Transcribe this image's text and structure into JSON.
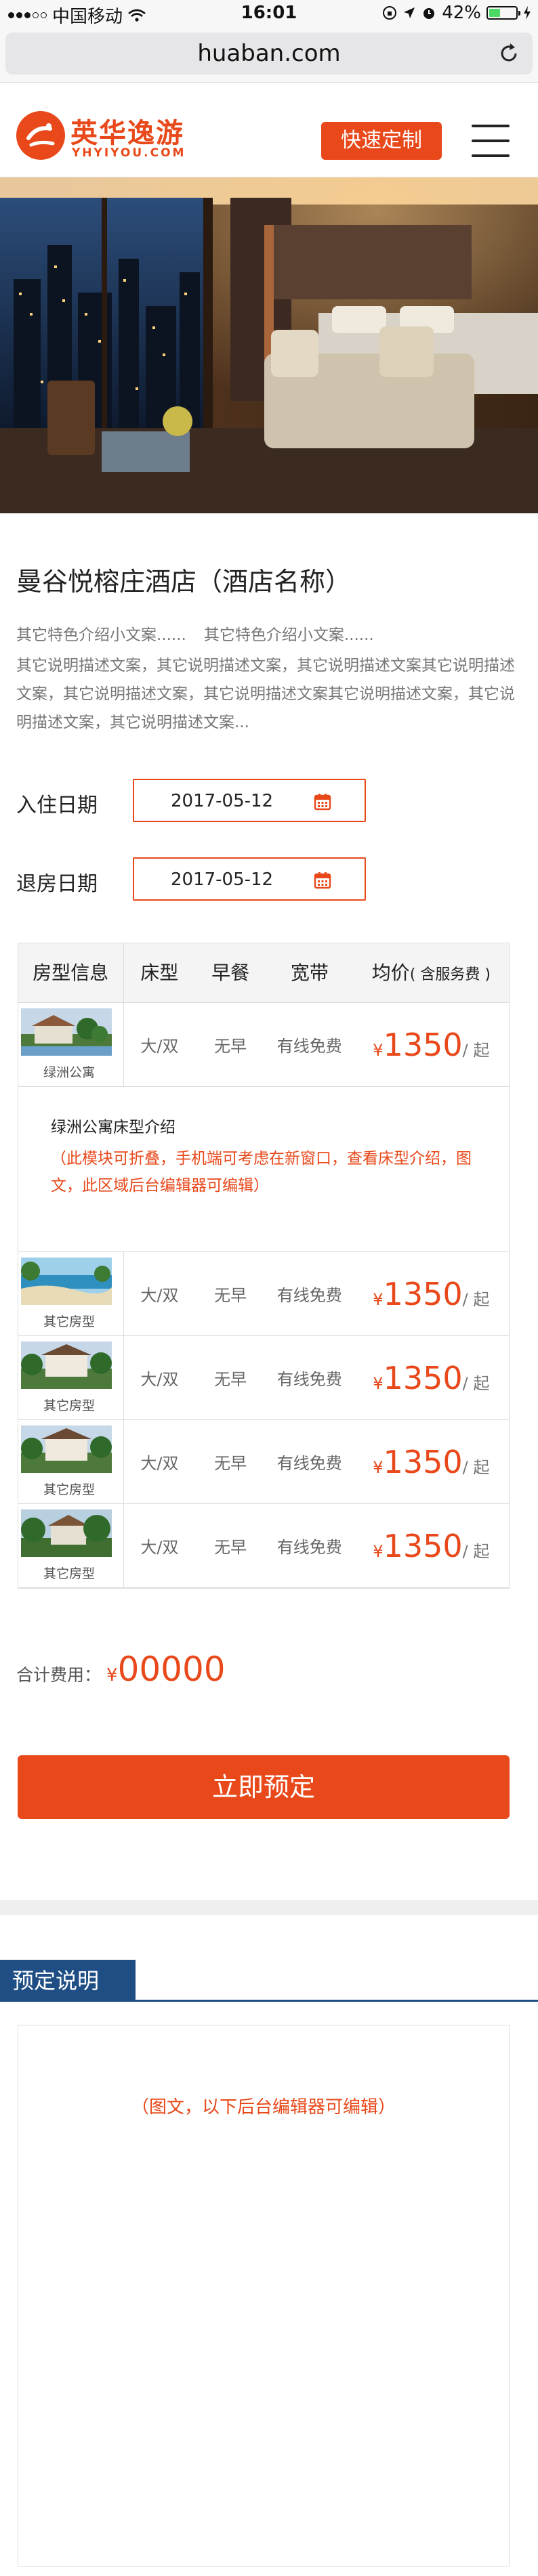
{
  "status_bar": {
    "carrier": "中国移动",
    "time": "16:01",
    "battery": "42%",
    "battery_level": 0.42
  },
  "browser": {
    "url": "huaban.com"
  },
  "header": {
    "logo_cn": "英华逸游",
    "logo_en": "YHYIYOU.COM",
    "quick_button": "快速定制"
  },
  "hotel": {
    "name": "曼谷悦榕庄酒店（酒店名称）",
    "intro": [
      "其它特色介绍小文案......",
      "其它特色介绍小文案......"
    ],
    "description": "其它说明描述文案，其它说明描述文案，其它说明描述文案其它说明描述文案，其它说明描述文案，其它说明描述文案其它说明描述文案，其它说明描述文案，其它说明描述文案..."
  },
  "booking": {
    "checkin_label": "入住日期",
    "checkin_value": "2017-05-12",
    "checkout_label": "退房日期",
    "checkout_value": "2017-05-12"
  },
  "room_table": {
    "headers": {
      "room": "房型信息",
      "bed": "床型",
      "breakfast": "早餐",
      "broadband": "宽带",
      "price": "均价",
      "price_note": "( 含服务费 )"
    },
    "rows": [
      {
        "name": "绿洲公寓",
        "bed": "大/双",
        "breakfast": "无早",
        "broadband": "有线免费",
        "currency": "¥",
        "price": "1350",
        "unit": "/ 起"
      },
      {
        "name": "其它房型",
        "bed": "大/双",
        "breakfast": "无早",
        "broadband": "有线免费",
        "currency": "¥",
        "price": "1350",
        "unit": "/ 起"
      },
      {
        "name": "其它房型",
        "bed": "大/双",
        "breakfast": "无早",
        "broadband": "有线免费",
        "currency": "¥",
        "price": "1350",
        "unit": "/ 起"
      },
      {
        "name": "其它房型",
        "bed": "大/双",
        "breakfast": "无早",
        "broadband": "有线免费",
        "currency": "¥",
        "price": "1350",
        "unit": "/ 起"
      },
      {
        "name": "其它房型",
        "bed": "大/双",
        "breakfast": "无早",
        "broadband": "有线免费",
        "currency": "¥",
        "price": "1350",
        "unit": "/ 起"
      }
    ],
    "intro_title": "绿洲公寓床型介绍",
    "intro_text": "（此模块可折叠，手机端可考虑在新窗口，查看床型介绍，图文，此区域后台编辑器可编辑）"
  },
  "total": {
    "label": "合计费用：",
    "currency": "¥",
    "value": "00000"
  },
  "book_button": "立即预定",
  "notes": {
    "title": "预定说明",
    "placeholder": "（图文，以下后台编辑器可编辑）"
  },
  "colors": {
    "accent": "#e8481a",
    "notes_header": "#1f4e85"
  }
}
